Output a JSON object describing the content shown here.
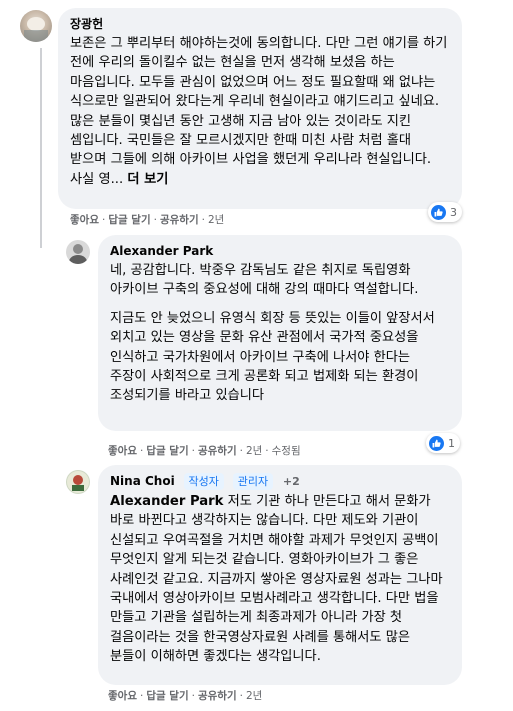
{
  "comments": [
    {
      "author": "장광헌",
      "text": "보존은 그 뿌리부터 해야하는것에 동의합니다. 다만 그런 얘기를 하기 전에 우리의 돌이킬수 없는 현실을 먼저 생각해 보셨음 하는 마음입니다. 모두들 관심이 없었으며 어느 정도 필요할때 왜 없냐는 식으로만 일관되어 왔다는게 우리네 현실이라고 얘기드리고 싶네요. 많은 분들이 몇십년 동안 고생해 지금 남아 있는 것이라도 지킨 셈입니다. 국민들은 잘 모르시겠지만 한때 미친 사람 처럼 홀대 받으며 그들에 의해 아카이브 사업을 했던게 우리나라 현실입니다. 사실 영...",
      "see_more": "더 보기",
      "actions": {
        "like": "좋아요",
        "reply": "답글 달기",
        "share": "공유하기",
        "time": "2년"
      },
      "reaction_count": "3"
    },
    {
      "author": "Alexander Park",
      "paragraphs": [
        "네, 공감합니다. 박중우 감독님도 같은 취지로 독립영화 아카이브 구축의 중요성에 대해 강의 때마다 역설합니다.",
        "지금도 안 늦었으니 유영식 회장 등 뜻있는 이들이 앞장서서 외치고 있는 영상을 문화 유산 관점에서 국가적 중요성을 인식하고 국가차원에서 아카이브 구축에 나서야 한다는 주장이 사회적으로 크게 공론화 되고 법제화 되는 환경이 조성되기를 바라고 있습니다"
      ],
      "actions": {
        "like": "좋아요",
        "reply": "답글 달기",
        "share": "공유하기",
        "time": "2년",
        "edited": "수정됨"
      },
      "reaction_count": "1"
    },
    {
      "author": "Nina Choi",
      "badges": [
        "작성자",
        "관리자"
      ],
      "extra_badges": "+2",
      "mention": "Alexander Park",
      "text": " 저도 기관 하나 만든다고 해서 문화가 바로 바뀐다고 생각하지는 않습니다. 다만 제도와 기관이 신설되고 우여곡절을 거치면 해야할 과제가 무엇인지 공백이 무엇인지 알게 되는것 같습니다. 영화아카이브가 그 좋은 사례인것 같고요. 지금까지 쌓아온 영상자료원 성과는 그나마 국내에서 영상아카이브 모범사례라고 생각합니다. 다만 법을 만들고 기관을 설립하는게 최종과제가 아니라 가장 첫 걸음이라는 것을 한국영상자료원 사례를 통해서도 많은 분들이 이해하면 좋겠다는 생각입니다.",
      "actions": {
        "like": "좋아요",
        "reply": "답글 달기",
        "share": "공유하기",
        "time": "2년"
      }
    }
  ],
  "colors": {
    "bubble": "#f0f2f5",
    "meta": "#65676b",
    "like": "#1877f2"
  },
  "icons": {
    "reaction": "like-thumb-icon"
  }
}
